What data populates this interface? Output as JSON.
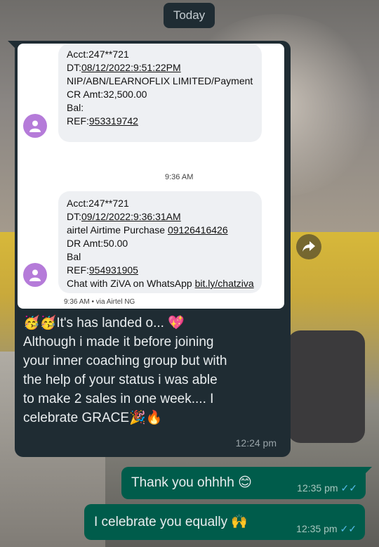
{
  "date_separator": "Today",
  "incoming_message": {
    "screenshot": {
      "sms1": {
        "acct": "Acct:247**721",
        "dt_prefix": "DT:",
        "dt_value": "08/12/2022:9:51:22PM",
        "desc": "NIP/ABN/LEARNOFLIX LIMITED/Payment",
        "amount": "CR Amt:32,500.00",
        "bal": "Bal:",
        "ref_prefix": "REF:",
        "ref_value": "953319742"
      },
      "between_time": "9:36 AM",
      "sms2": {
        "acct": "Acct:247**721",
        "dt_prefix": "DT:",
        "dt_value": "09/12/2022:9:36:31AM",
        "desc_prefix": "airtel Airtime Purchase ",
        "desc_number": "09126416426",
        "amount": "DR Amt:50.00",
        "bal": "Bal",
        "ref_prefix": "REF:",
        "ref_value": "954931905",
        "ziva_prefix": "Chat with ZiVA on WhatsApp ",
        "ziva_link": "bit.ly/chatziva"
      },
      "via_text": "9:36 AM • via Airtel NG"
    },
    "text_lines": {
      "l1_emoji": "🥳🥳",
      "l1": "It's has landed o... ",
      "l1_heart": "💖",
      "l2": "Although i made it before joining",
      "l3": "your inner coaching group but with",
      "l4": "the help of your status i was able",
      "l5": "to make 2 sales in one week.... I",
      "l6": "celebrate GRACE",
      "l6_emoji": "🎉🔥"
    },
    "time": "12:24 pm"
  },
  "outgoing_messages": [
    {
      "text": "Thank you ohhhh ",
      "emoji": "😊",
      "time": "12:35 pm",
      "ticks": "✓✓"
    },
    {
      "text": "I celebrate you equally ",
      "emoji": "🙌",
      "time": "12:35 pm",
      "ticks": "✓✓"
    }
  ],
  "icons": {
    "forward": "forward-icon",
    "avatar": "person-icon",
    "read_receipt": "double-check-icon"
  },
  "colors": {
    "incoming_bubble": "#1f2c33",
    "outgoing_bubble": "#005c4b",
    "avatar": "#b57bd9",
    "read_ticks": "#53bdeb"
  }
}
